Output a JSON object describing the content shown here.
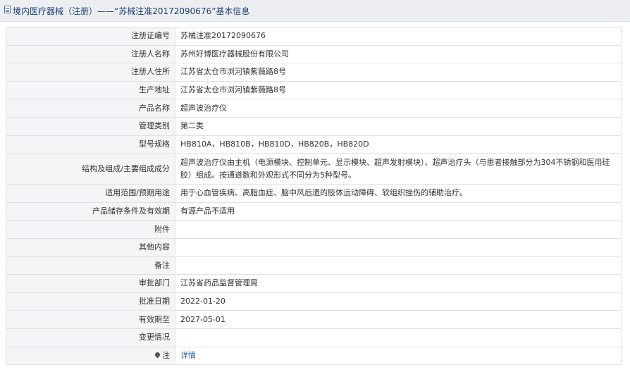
{
  "header": {
    "title": "境内医疗器械（注册）——“苏械注准20172090676”基本信息"
  },
  "rows": [
    {
      "label": "注册证编号",
      "value": "苏械注准20172090676"
    },
    {
      "label": "注册人名称",
      "value": "苏州好博医疗器械股份有限公司"
    },
    {
      "label": "注册人住所",
      "value": "江苏省太仓市浏河镇紫薇路8号"
    },
    {
      "label": "生产地址",
      "value": "江苏省太仓市浏河镇紫薇路8号"
    },
    {
      "label": "产品名称",
      "value": "超声波治疗仪"
    },
    {
      "label": "管理类别",
      "value": "第二类"
    },
    {
      "label": "型号规格",
      "value": "HB810A，HB810B，HB810D，HB820B，HB820D"
    },
    {
      "label": "结构及组成/主要组成成分",
      "value": "超声波治疗仪由主机（电源模块、控制单元、显示模块、超声发射模块）、超声治疗头（与患者接触部分为304不锈钢和医用硅胶）组成。按通道数和外观形式不同分为5种型号。"
    },
    {
      "label": "适用范围/预期用途",
      "value": "用于心血管疾病、高脂血症、脑中风后遗的肢体运动障碍、软组织挫伤的辅助治疗。"
    },
    {
      "label": "产品储存条件及有效期",
      "value": "有源产品不适用"
    },
    {
      "label": "附件",
      "value": ""
    },
    {
      "label": "其他内容",
      "value": ""
    },
    {
      "label": "备注",
      "value": ""
    },
    {
      "label": "审批部门",
      "value": "江苏省药品监督管理局"
    },
    {
      "label": "批准日期",
      "value": "2022-01-20"
    },
    {
      "label": "有效期至",
      "value": "2027-05-01"
    },
    {
      "label": "变更情况",
      "value": ""
    },
    {
      "label": "注",
      "value": "详情",
      "icon": "pin-icon"
    }
  ]
}
